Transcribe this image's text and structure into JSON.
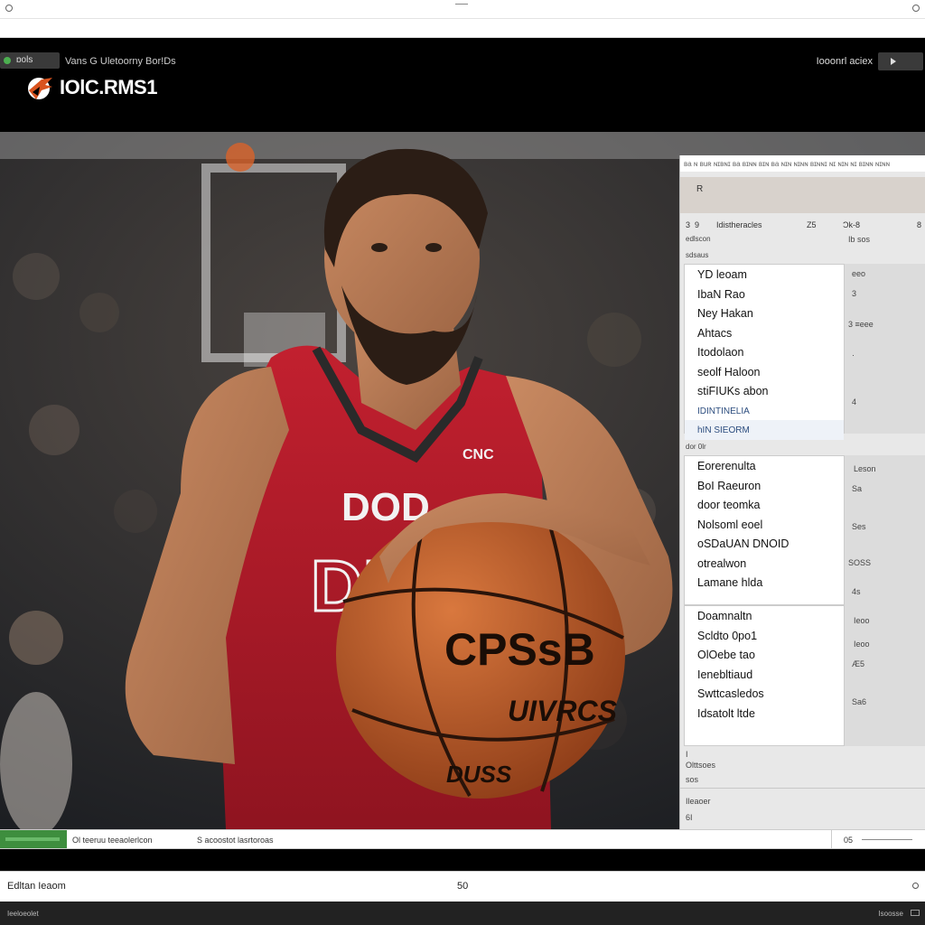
{
  "window": {
    "title_center": "—"
  },
  "header": {
    "pill_label": "ɒols",
    "nav_text": "Vans   G   Uletoorny Bor!Ds",
    "logo_text": "IOlC.RMS1",
    "right_text": "Iooonrl  aciex"
  },
  "panel": {
    "strip_text": "ʙa ɴ ʙuʀ ɴɪʙɴɪ ʙa ʙɪɴɴ ʙɪɴ ʙa ɴɪɴ ɴɪɴɴ ʙɪɴɴɪ ɴɪ ɴɪɴ ɴɪ ʙɪɴɴ ɴɪɴɴ",
    "tab_label": "R",
    "col_headers": [
      "3",
      "9",
      "Idistheracles",
      "Z5",
      "Ɔk-8",
      "8"
    ],
    "section1_title": "Edlscon",
    "section1_sub": "sdsaus",
    "section1_right": "Ib sos",
    "list1": [
      "YD leoam",
      "IbaN Rao",
      "Ney Hakan",
      "Ahtacs",
      "Itodolaon",
      "seolf Haloon",
      "stiFIUKs abon",
      "IDINTINELIA",
      "hIN SIEORM"
    ],
    "list1_right": [
      "eeo",
      "3",
      "3 ≡eee",
      "·",
      "4"
    ],
    "section2_title": "DOR 0LR",
    "list2": [
      "Eorerenulta",
      "BoI Raeuron",
      "door teomka",
      "Nolsoml eoel",
      "oSDaUAN DNOID",
      "otrealwon",
      "Lamane hlda"
    ],
    "list2_right": [
      "Leson",
      "Sa",
      "Ses",
      "SOSS",
      "4s"
    ],
    "list3": [
      "Doamnaltn",
      "Scldto 0po1",
      "OlOebe tao",
      "Ienebltiaud",
      "Swttcasledos",
      "Idsatolt ltde"
    ],
    "list3_right": [
      "Ieoo",
      "Ieoo",
      "Æ5",
      "Sa6"
    ],
    "foot1": "I",
    "foot2": "Olttsoes",
    "foot3": "sos",
    "foot4": "Ileaoer",
    "foot5": "6I"
  },
  "stage": {
    "jersey_text": "DOD",
    "jersey_letter": "DI",
    "chest_logo": "CNC",
    "ball_text_1": "CPSsB",
    "ball_text_2": "UIVRCS",
    "ball_text_3": "DUSS"
  },
  "statusbar": {
    "left_text": "Ol teeruu teeaolerlcon",
    "mid_text": "S acoostot lasrtoroas",
    "zoom": "05"
  },
  "bottombar": {
    "left_text": "Edltan Ieaom",
    "mid_text": "50"
  },
  "footer": {
    "left_text": "Ieeloeolet",
    "right_text": "Isoosse"
  },
  "colors": {
    "jersey": "#b31b2c",
    "ball": "#c2622d",
    "header_bg": "#000000",
    "status_green": "#3e8e3e"
  }
}
